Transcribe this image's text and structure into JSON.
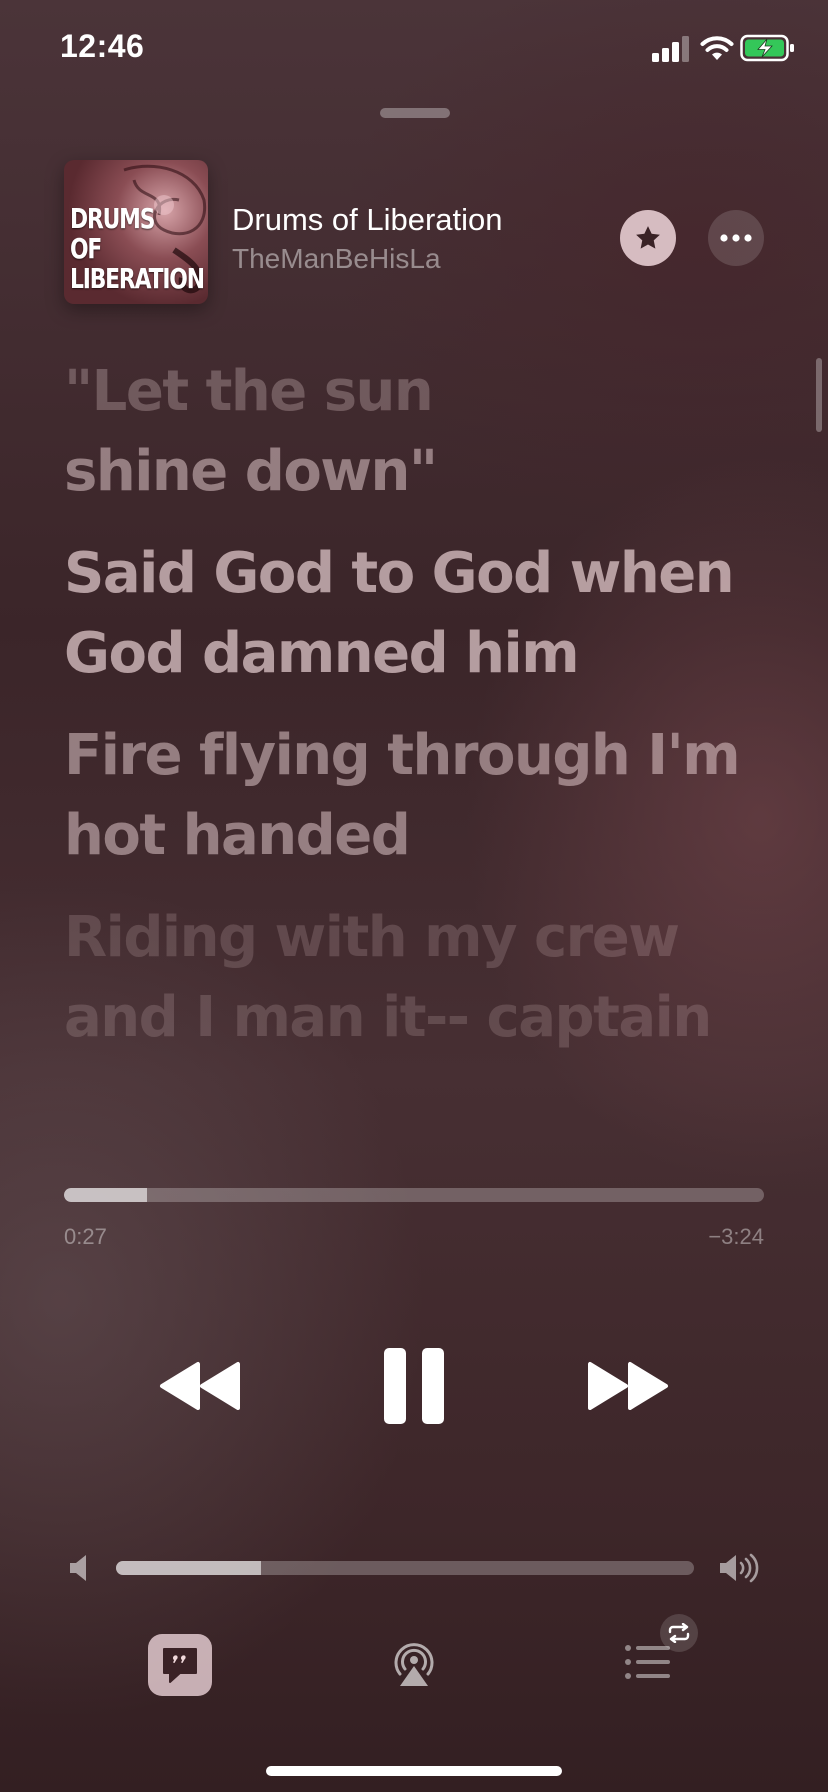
{
  "status_bar": {
    "time": "12:46"
  },
  "now_playing": {
    "title": "Drums of Liberation",
    "artist": "TheManBeHisLa",
    "artwork_text": [
      "DRUMS",
      "OF",
      "LIBERATION"
    ]
  },
  "lyrics": [
    {
      "lines": [
        "\"Let the sun",
        "shine down\""
      ],
      "state": "past"
    },
    {
      "lines": [
        "Said God to God when",
        "God damned him"
      ],
      "state": "active"
    },
    {
      "lines": [
        "Fire flying through I'm",
        "hot handed"
      ],
      "state": "upcoming"
    },
    {
      "lines": [
        "Riding with my crew",
        "and I man it-- captain"
      ],
      "state": "faded"
    }
  ],
  "playback": {
    "elapsed": "0:27",
    "remaining": "−3:24",
    "progress_fraction": 0.118,
    "volume_fraction": 0.25,
    "state": "playing"
  },
  "icons": {
    "star": "star-icon",
    "more": "more-icon",
    "rewind": "rewind-icon",
    "pause": "pause-icon",
    "forward": "fast-forward-icon",
    "volume_low": "volume-low-icon",
    "volume_high": "volume-high-icon",
    "lyrics": "lyrics-icon",
    "airplay": "airplay-icon",
    "queue": "queue-icon",
    "repeat": "repeat-icon"
  },
  "colors": {
    "background": "#3d2629",
    "battery_fill": "#34c759"
  }
}
